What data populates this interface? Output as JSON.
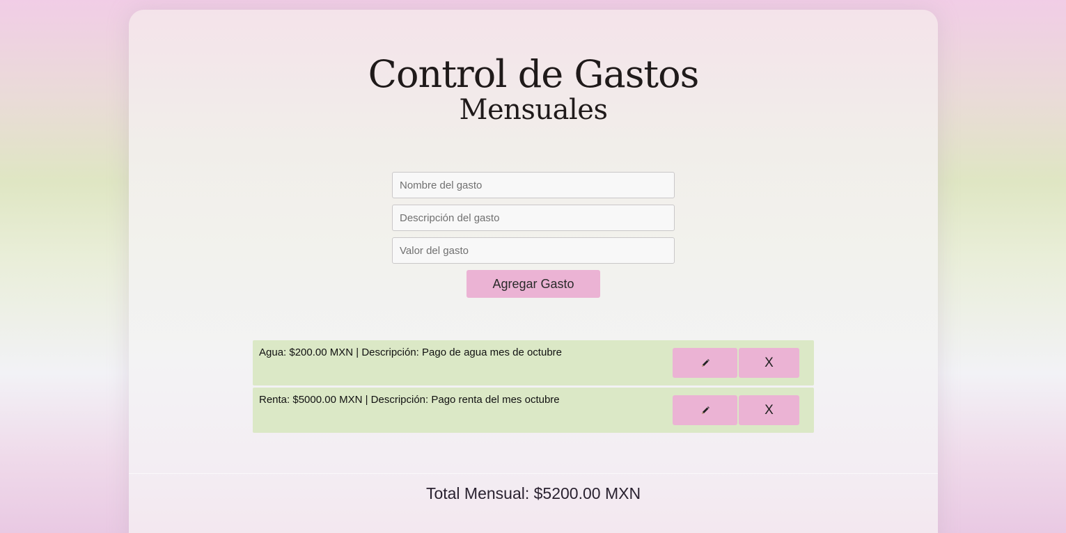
{
  "header": {
    "title_line1": "Control de Gastos",
    "title_line2": "Mensuales"
  },
  "form": {
    "name_placeholder": "Nombre del gasto",
    "description_placeholder": "Descripción del gasto",
    "value_placeholder": "Valor del gasto",
    "name_value": "",
    "description_value": "",
    "value_value": "",
    "add_button_label": "Agregar Gasto"
  },
  "expenses": [
    {
      "text": "Agua: $200.00 MXN | Descripción: Pago de agua mes de octubre",
      "edit_icon": "pencil-icon",
      "delete_label": "X"
    },
    {
      "text": "Renta: $5000.00 MXN | Descripción: Pago renta del mes octubre",
      "edit_icon": "pencil-icon",
      "delete_label": "X"
    }
  ],
  "summary": {
    "total_text": "Total Mensual: $5200.00 MXN"
  },
  "colors": {
    "accent_pink": "#ebb3d4",
    "row_green": "#dbe8c6"
  }
}
